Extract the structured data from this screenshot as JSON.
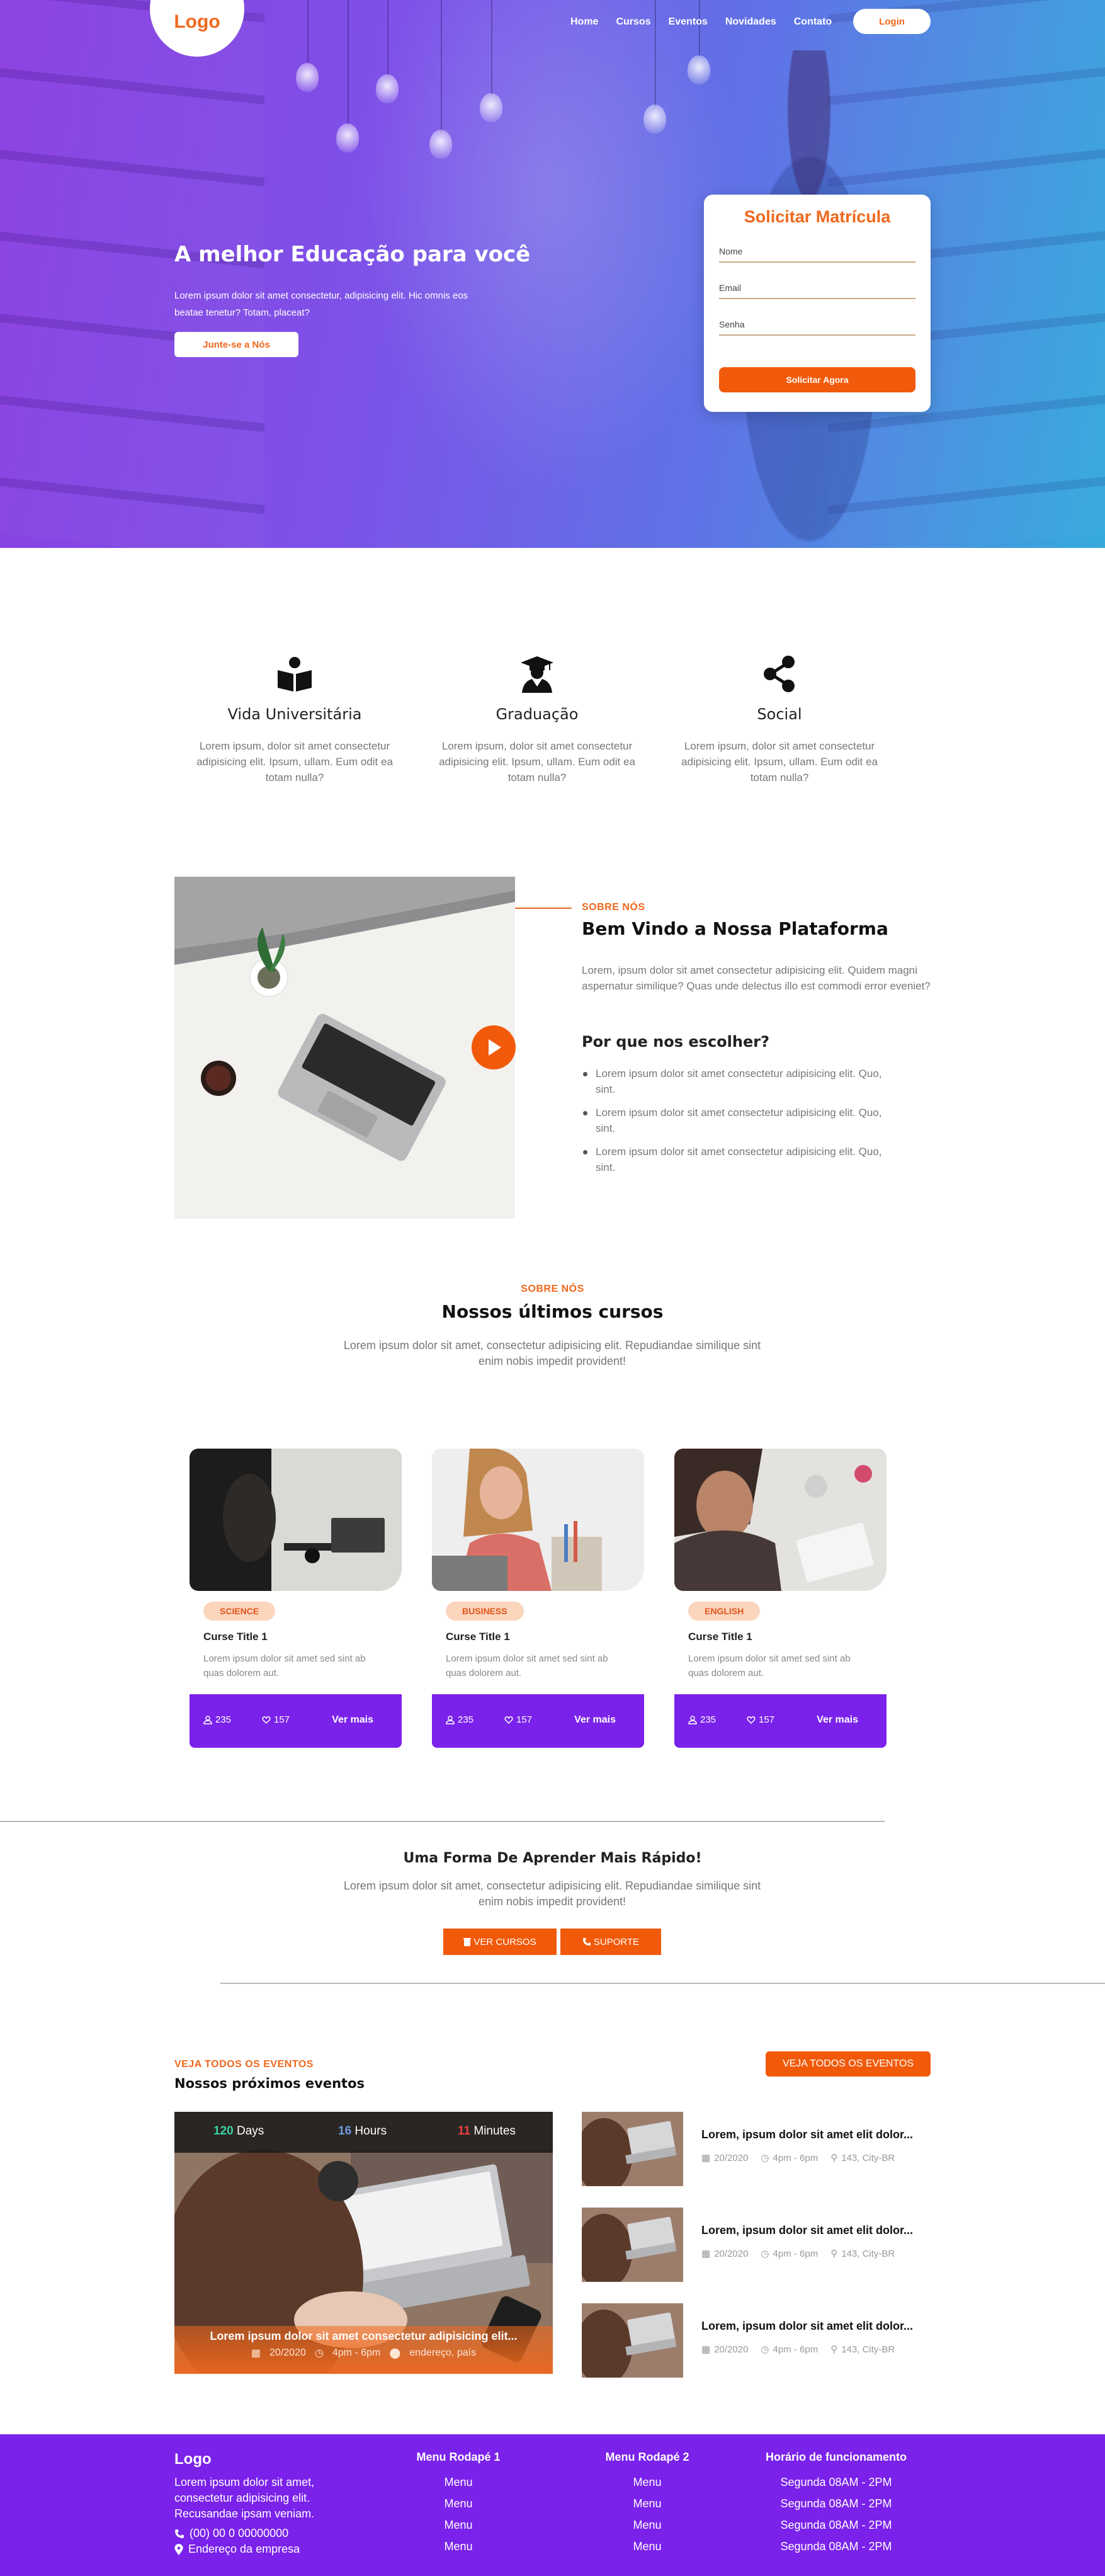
{
  "header": {
    "logo": "Logo",
    "nav": [
      "Home",
      "Cursos",
      "Eventos",
      "Novidades",
      "Contato"
    ],
    "login": "Login"
  },
  "hero": {
    "title": "A melhor Educação para você",
    "text": "Lorem ipsum dolor sit amet consectetur, adipisicing elit. Hic omnis eos beatae tenetur? Totam, placeat?",
    "button": "Junte-se a Nós"
  },
  "enroll_form": {
    "title": "Solicitar Matrícula",
    "fields": [
      "Nome",
      "Email",
      "Senha"
    ],
    "submit": "Solicitar Agora"
  },
  "features": [
    {
      "icon": "book-reader-icon",
      "title": "Vida Universitária",
      "text": "Lorem ipsum, dolor sit amet consectetur adipisicing elit. Ipsum, ullam. Eum odit ea totam nulla?"
    },
    {
      "icon": "graduate-icon",
      "title": "Graduação",
      "text": "Lorem ipsum, dolor sit amet consectetur adipisicing elit. Ipsum, ullam. Eum odit ea totam nulla?"
    },
    {
      "icon": "share-icon",
      "title": "Social",
      "text": "Lorem ipsum, dolor sit amet consectetur adipisicing elit. Ipsum, ullam. Eum odit ea totam nulla?"
    }
  ],
  "about": {
    "kicker": "SOBRE NÓS",
    "title": "Bem Vindo a Nossa Plataforma",
    "text": "Lorem, ipsum dolor sit amet consectetur adipisicing elit. Quidem magni aspernatur similique? Quas unde delectus illo est commodi error eveniet?",
    "why_title": "Por que nos escolher?",
    "why_items": [
      "Lorem ipsum dolor sit amet consectetur adipisicing elit. Quo, sint.",
      "Lorem ipsum dolor sit amet consectetur adipisicing elit. Quo, sint.",
      "Lorem ipsum dolor sit amet consectetur adipisicing elit. Quo, sint."
    ]
  },
  "courses": {
    "kicker": "SOBRE NÓS",
    "title": "Nossos últimos cursos",
    "text": "Lorem ipsum dolor sit amet, consectetur adipisicing elit. Repudiandae similique sint enim nobis impedit provident!",
    "items": [
      {
        "tag": "SCIENCE",
        "title": "Curse Title 1",
        "text": "Lorem ipsum dolor sit amet sed sint ab quas dolorem aut.",
        "students": "235",
        "likes": "157",
        "more": "Ver mais"
      },
      {
        "tag": "BUSINESS",
        "title": "Curse Title 1",
        "text": "Lorem ipsum dolor sit amet sed sint ab quas dolorem aut.",
        "students": "235",
        "likes": "157",
        "more": "Ver mais"
      },
      {
        "tag": "ENGLISH",
        "title": "Curse Title 1",
        "text": "Lorem ipsum dolor sit amet sed sint ab quas dolorem aut.",
        "students": "235",
        "likes": "157",
        "more": "Ver mais"
      }
    ]
  },
  "faster": {
    "title": "Uma Forma De Aprender Mais Rápido!",
    "text": "Lorem ipsum dolor sit amet, consectetur adipisicing elit. Repudiandae similique sint enim nobis impedit provident!",
    "btn_courses": "VER CURSOS",
    "btn_support": "SUPORTE"
  },
  "events": {
    "kicker": "VEJA TODOS OS EVENTOS",
    "title": "Nossos próximos eventos",
    "button": "VEJA TODOS OS EVENTOS",
    "countdown": {
      "days_num": "120",
      "days": "Days",
      "hours_num": "16",
      "hours": "Hours",
      "minutes_num": "11",
      "minutes": "Minutes"
    },
    "featured": {
      "title": "Lorem ipsum dolor sit amet consectetur adipisicing elit...",
      "date": "20/2020",
      "time": "4pm - 6pm",
      "place": "endereço, país"
    },
    "list": [
      {
        "title": "Lorem, ipsum dolor sit amet elit dolor...",
        "date": "20/2020",
        "time": "4pm - 6pm",
        "place": "143, City-BR"
      },
      {
        "title": "Lorem, ipsum dolor sit amet elit dolor...",
        "date": "20/2020",
        "time": "4pm - 6pm",
        "place": "143, City-BR"
      },
      {
        "title": "Lorem, ipsum dolor sit amet elit dolor...",
        "date": "20/2020",
        "time": "4pm - 6pm",
        "place": "143, City-BR"
      }
    ]
  },
  "footer": {
    "logo": "Logo",
    "about": "Lorem ipsum dolor sit amet, consectetur adipisicing elit. Recusandae ipsam veniam.",
    "phone": "(00) 00 0 00000000",
    "address": "Endereço da empresa",
    "menu1_title": "Menu Rodapé 1",
    "menu1": [
      "Menu",
      "Menu",
      "Menu",
      "Menu"
    ],
    "menu2_title": "Menu Rodapé 2",
    "menu2": [
      "Menu",
      "Menu",
      "Menu",
      "Menu"
    ],
    "hours_title": "Horário de funcionamento",
    "hours": [
      "Segunda 08AM - 2PM",
      "Segunda 08AM - 2PM",
      "Segunda 08AM - 2PM",
      "Segunda 08AM - 2PM"
    ]
  },
  "colors": {
    "accent": "#f25a0b",
    "purple": "#7a22ea",
    "hero_from": "#8b3fe0",
    "hero_to": "#35aadc"
  }
}
